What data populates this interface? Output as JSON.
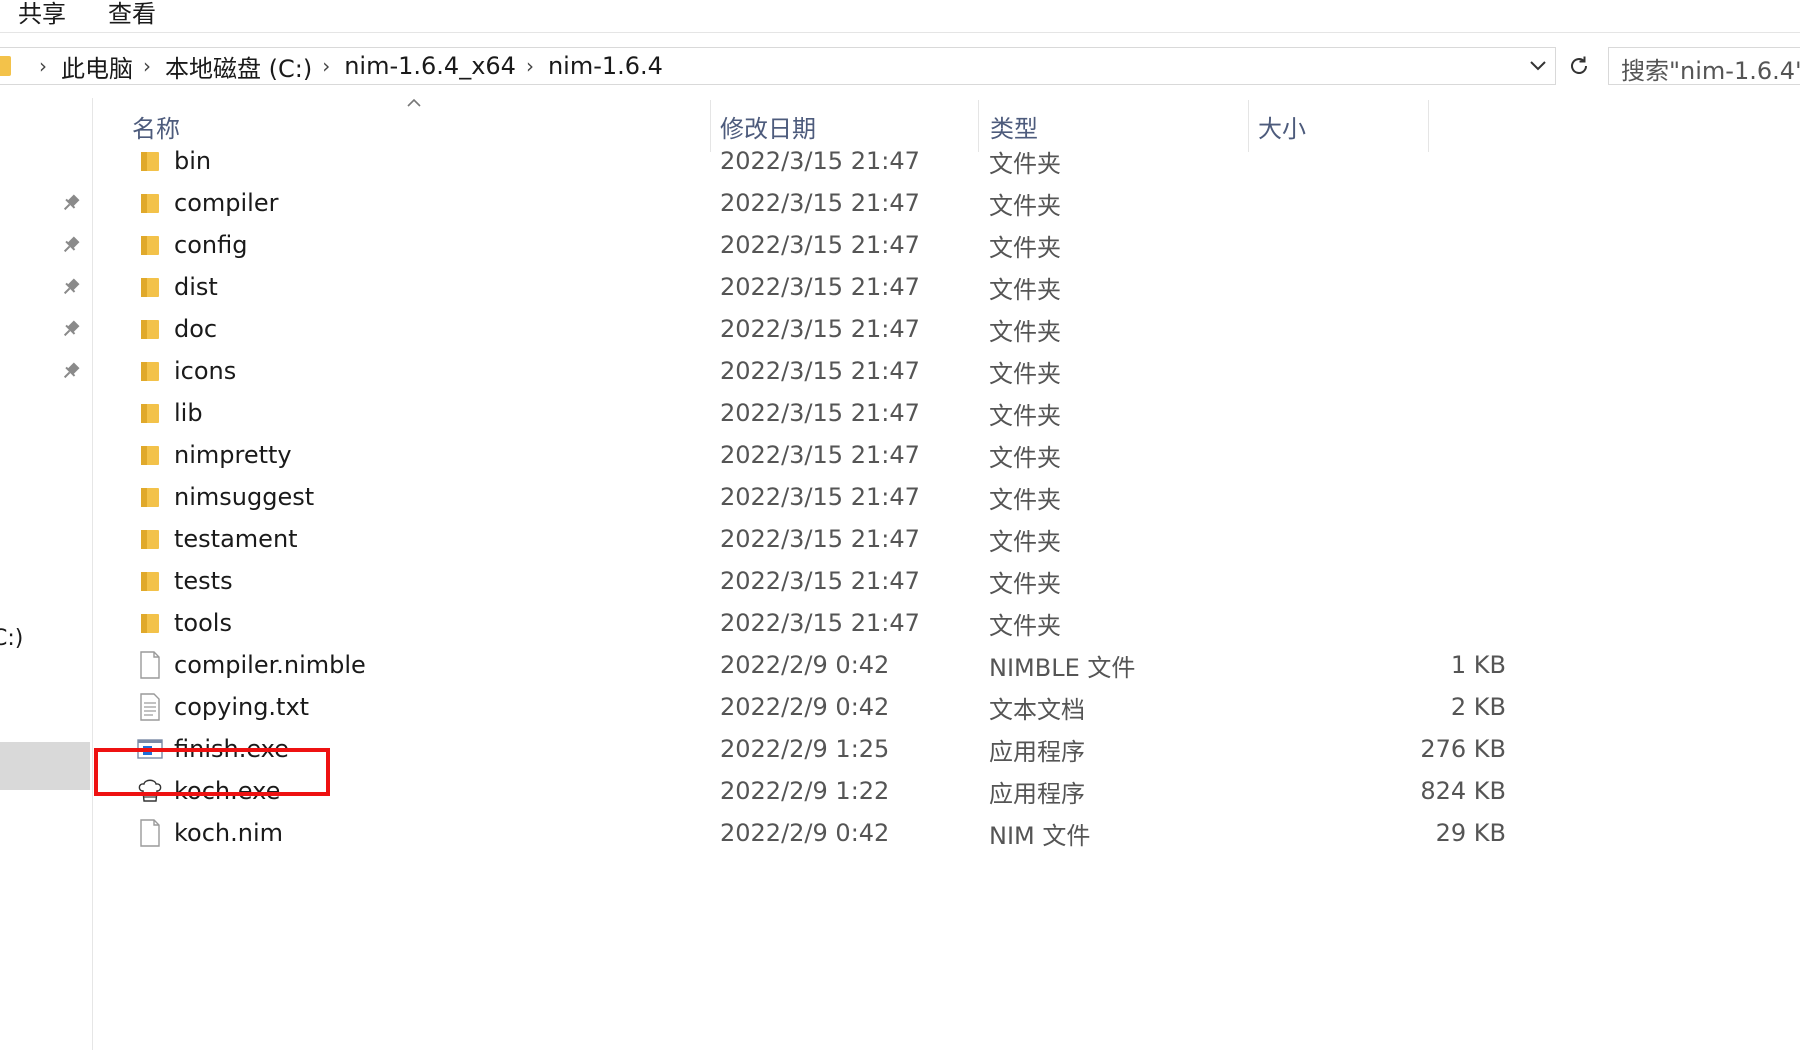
{
  "ribbon": {
    "tabs": [
      "共享",
      "查看"
    ]
  },
  "address_bar": {
    "breadcrumbs": [
      "此电脑",
      "本地磁盘 (C:)",
      "nim-1.6.4_x64",
      "nim-1.6.4"
    ]
  },
  "search": {
    "placeholder": "搜索\"nim-1.6.4\""
  },
  "nav_pane": {
    "drive_fragment": "C:)"
  },
  "columns": {
    "name": "名称",
    "date": "修改日期",
    "type": "类型",
    "size": "大小",
    "sorted_by": "name",
    "sort_direction": "ascending"
  },
  "files": [
    {
      "name": "bin",
      "date": "2022/3/15 21:47",
      "type": "文件夹",
      "size": "",
      "icon": "folder-icon"
    },
    {
      "name": "compiler",
      "date": "2022/3/15 21:47",
      "type": "文件夹",
      "size": "",
      "icon": "folder-icon"
    },
    {
      "name": "config",
      "date": "2022/3/15 21:47",
      "type": "文件夹",
      "size": "",
      "icon": "folder-icon"
    },
    {
      "name": "dist",
      "date": "2022/3/15 21:47",
      "type": "文件夹",
      "size": "",
      "icon": "folder-icon"
    },
    {
      "name": "doc",
      "date": "2022/3/15 21:47",
      "type": "文件夹",
      "size": "",
      "icon": "folder-icon"
    },
    {
      "name": "icons",
      "date": "2022/3/15 21:47",
      "type": "文件夹",
      "size": "",
      "icon": "folder-icon"
    },
    {
      "name": "lib",
      "date": "2022/3/15 21:47",
      "type": "文件夹",
      "size": "",
      "icon": "folder-icon"
    },
    {
      "name": "nimpretty",
      "date": "2022/3/15 21:47",
      "type": "文件夹",
      "size": "",
      "icon": "folder-icon"
    },
    {
      "name": "nimsuggest",
      "date": "2022/3/15 21:47",
      "type": "文件夹",
      "size": "",
      "icon": "folder-icon"
    },
    {
      "name": "testament",
      "date": "2022/3/15 21:47",
      "type": "文件夹",
      "size": "",
      "icon": "folder-icon"
    },
    {
      "name": "tests",
      "date": "2022/3/15 21:47",
      "type": "文件夹",
      "size": "",
      "icon": "folder-icon"
    },
    {
      "name": "tools",
      "date": "2022/3/15 21:47",
      "type": "文件夹",
      "size": "",
      "icon": "folder-icon"
    },
    {
      "name": "compiler.nimble",
      "date": "2022/2/9 0:42",
      "type": "NIMBLE 文件",
      "size": "1 KB",
      "icon": "blank-file-icon"
    },
    {
      "name": "copying.txt",
      "date": "2022/2/9 0:42",
      "type": "文本文档",
      "size": "2 KB",
      "icon": "text-file-icon"
    },
    {
      "name": "finish.exe",
      "date": "2022/2/9 1:25",
      "type": "应用程序",
      "size": "276 KB",
      "icon": "application-icon"
    },
    {
      "name": "koch.exe",
      "date": "2022/2/9 1:22",
      "type": "应用程序",
      "size": "824 KB",
      "icon": "chef-hat-icon"
    },
    {
      "name": "koch.nim",
      "date": "2022/2/9 0:42",
      "type": "NIM 文件",
      "size": "29 KB",
      "icon": "blank-file-icon"
    }
  ],
  "highlighted_file": "finish.exe",
  "colors": {
    "highlight_border": "#ee1111",
    "folder": "#f3c24a",
    "header_text": "#4d5b7c"
  }
}
